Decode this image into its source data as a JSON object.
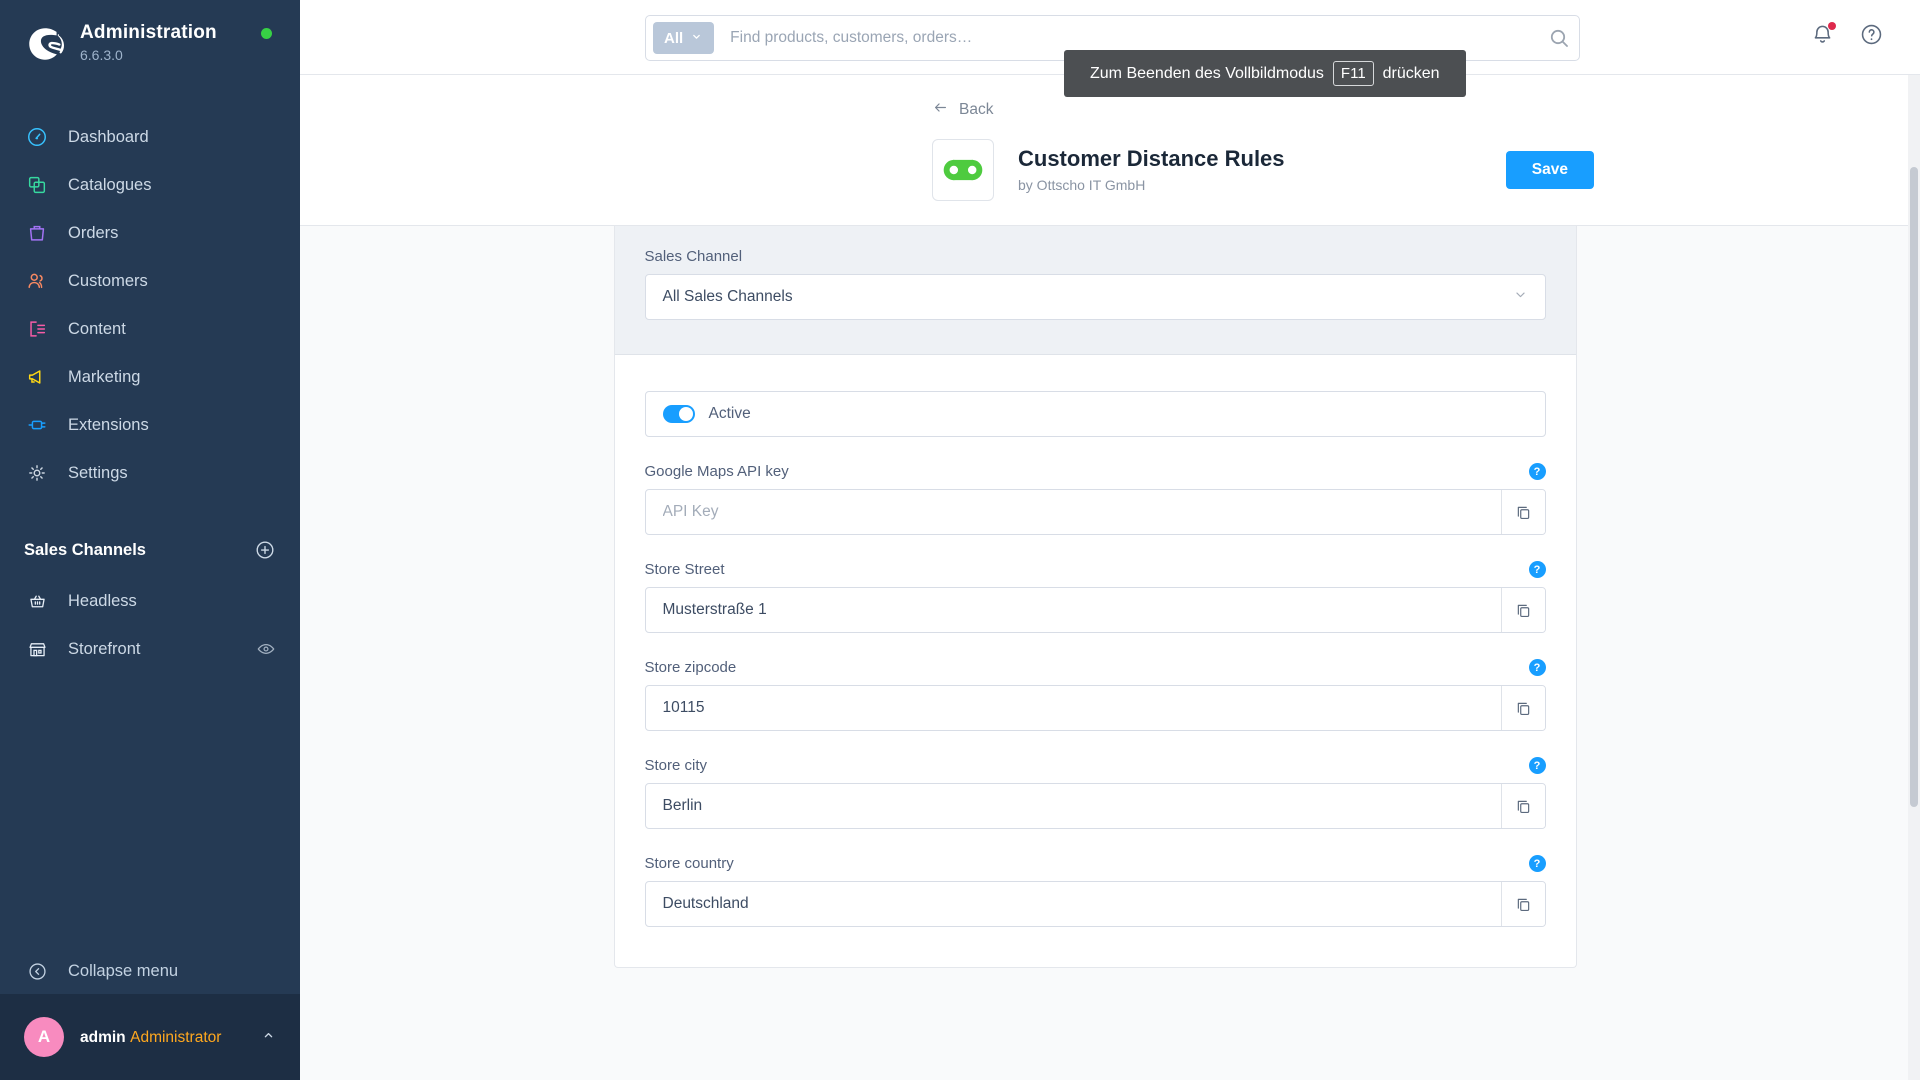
{
  "sidebar": {
    "brand": {
      "title": "Administration",
      "version": "6.6.3.0",
      "status_color": "#37D045",
      "logo_icon": "shopware-logo-icon"
    },
    "items": [
      {
        "label": "Dashboard",
        "icon": "dashboard-icon",
        "color": "#37C2FF"
      },
      {
        "label": "Catalogues",
        "icon": "catalogues-icon",
        "color": "#37D9A0"
      },
      {
        "label": "Orders",
        "icon": "orders-icon",
        "color": "#A373F5"
      },
      {
        "label": "Customers",
        "icon": "customers-icon",
        "color": "#F88962"
      },
      {
        "label": "Content",
        "icon": "content-icon",
        "color": "#F85CA6"
      },
      {
        "label": "Marketing",
        "icon": "marketing-icon",
        "color": "#FFD814"
      },
      {
        "label": "Extensions",
        "icon": "extensions-icon",
        "color": "#189EFF"
      },
      {
        "label": "Settings",
        "icon": "settings-gear-icon",
        "color": "#CBD5E0"
      }
    ],
    "section": {
      "title": "Sales Channels",
      "add_icon": "plus-circle-icon"
    },
    "channels": [
      {
        "label": "Headless",
        "icon": "basket-icon",
        "right_icon": ""
      },
      {
        "label": "Storefront",
        "icon": "storefront-icon",
        "right_icon": "eye-icon"
      }
    ],
    "collapse": {
      "label": "Collapse menu",
      "icon": "chevron-left-circle-icon"
    },
    "user": {
      "initial": "A",
      "name": "admin",
      "role": "Administrator",
      "caret_icon": "chevron-up-icon",
      "avatar_color": "#F88BBF"
    }
  },
  "topbar": {
    "search": {
      "scope": "All",
      "scope_caret_icon": "chevron-down-icon",
      "placeholder": "Find products, customers, orders…",
      "value": "",
      "submit_icon": "search-icon"
    },
    "notifications_icon": "bell-icon",
    "notifications_has_badge": true,
    "help_icon": "question-circle-icon"
  },
  "fullscreen_toast": {
    "text_before": "Zum Beenden des Vollbildmodus",
    "key": "F11",
    "text_after": "drücken"
  },
  "page_header": {
    "back_label": "Back",
    "back_icon": "arrow-left-icon",
    "app_icon": "plugin-logo-icon",
    "title": "Customer Distance Rules",
    "subtitle": "by Ottscho IT GmbH",
    "save_label": "Save",
    "save_color": "#189EFF"
  },
  "form": {
    "sales_channel": {
      "label": "Sales Channel",
      "value": "All Sales Channels",
      "caret_icon": "chevron-down-icon"
    },
    "active_toggle": {
      "label": "Active",
      "checked": true
    },
    "help_badge_glyph": "?",
    "copy_icon": "copy-icon",
    "fields": [
      {
        "label": "Google Maps API key",
        "value": "",
        "placeholder": "API Key",
        "has_help": true,
        "has_copy": true
      },
      {
        "label": "Store Street",
        "value": "Musterstraße 1",
        "placeholder": "",
        "has_help": true,
        "has_copy": true
      },
      {
        "label": "Store zipcode",
        "value": "10115",
        "placeholder": "",
        "has_help": true,
        "has_copy": true
      },
      {
        "label": "Store city",
        "value": "Berlin",
        "placeholder": "",
        "has_help": true,
        "has_copy": true
      },
      {
        "label": "Store country",
        "value": "Deutschland",
        "placeholder": "",
        "has_help": true,
        "has_copy": true
      }
    ]
  }
}
